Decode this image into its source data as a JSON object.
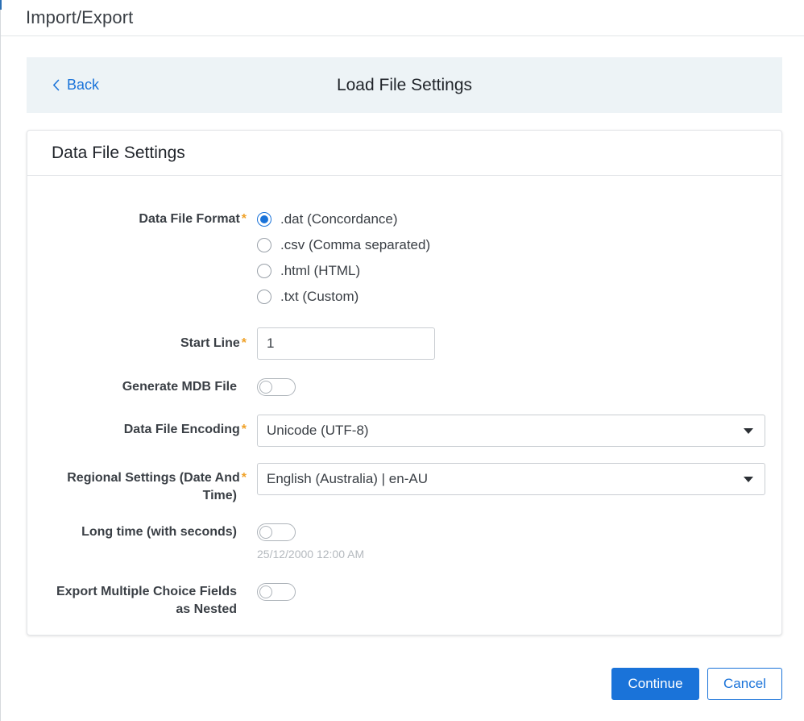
{
  "window": {
    "title": "Import/Export"
  },
  "nav": {
    "back_label": "Back",
    "page_title": "Load File Settings"
  },
  "card": {
    "title": "Data File Settings"
  },
  "form": {
    "data_file_format": {
      "label": "Data File Format",
      "required_mark": "*",
      "options": [
        {
          "label": ".dat (Concordance)",
          "checked": true
        },
        {
          "label": ".csv (Comma separated)",
          "checked": false
        },
        {
          "label": ".html (HTML)",
          "checked": false
        },
        {
          "label": ".txt (Custom)",
          "checked": false
        }
      ]
    },
    "start_line": {
      "label": "Start Line",
      "required_mark": "*",
      "value": "1"
    },
    "generate_mdb": {
      "label": "Generate MDB File",
      "on": false
    },
    "encoding": {
      "label": "Data File Encoding",
      "required_mark": "*",
      "value": "Unicode (UTF-8)"
    },
    "regional": {
      "label_line1": "Regional Settings (Date And",
      "label_line2": "Time)",
      "required_mark": "*",
      "value": "English (Australia) | en-AU"
    },
    "long_time": {
      "label": "Long time (with seconds)",
      "on": false,
      "hint": "25/12/2000 12:00 AM"
    },
    "export_nested": {
      "label_line1": "Export Multiple Choice Fields",
      "label_line2": "as Nested",
      "on": false
    }
  },
  "footer": {
    "continue_label": "Continue",
    "cancel_label": "Cancel"
  },
  "colors": {
    "accent": "#1a73d9",
    "required": "#f0a229",
    "nav_strip_bg": "#edf3f6"
  }
}
